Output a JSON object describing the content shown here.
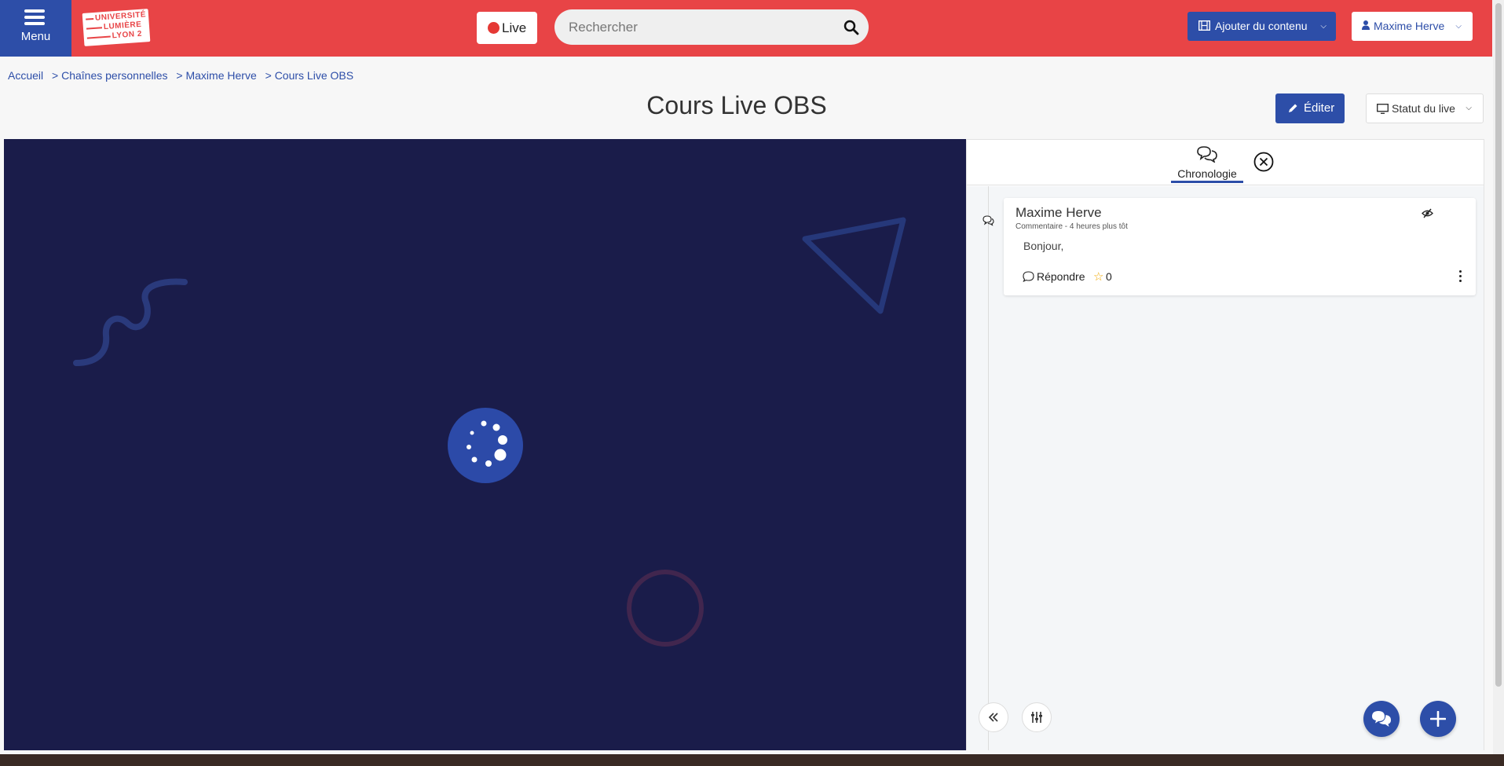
{
  "header": {
    "menu_label": "Menu",
    "logo_lines": [
      "UNIVERSITÉ",
      "LUMIÈRE",
      "LYON 2"
    ],
    "live_label": "Live",
    "search_placeholder": "Rechercher",
    "add_content_label": "Ajouter du contenu",
    "user_label": "Maxime Herve"
  },
  "breadcrumb": [
    {
      "label": "Accueil"
    },
    {
      "label": "> Chaînes personnelles"
    },
    {
      "label": "> Maxime Herve"
    },
    {
      "label": "> Cours Live OBS"
    }
  ],
  "page": {
    "title": "Cours Live OBS",
    "edit_label": "Éditer",
    "status_label": "Statut du live"
  },
  "panel": {
    "tab_label": "Chronologie",
    "comments": [
      {
        "author": "Maxime Herve",
        "meta": "Commentaire - 4 heures plus tôt",
        "text": "Bonjour,",
        "reply_label": "Répondre",
        "stars": "0"
      }
    ]
  },
  "colors": {
    "brand_red": "#e84446",
    "brand_blue": "#2d4ea8",
    "player_bg": "#1a1c4a"
  },
  "icons": {
    "menu": "hamburger-icon",
    "live": "red-dot-icon",
    "search": "magnifier-icon",
    "add": "film-icon",
    "user": "user-icon",
    "edit": "pencil-icon",
    "status": "monitor-icon",
    "tab": "chat-bubbles-icon",
    "close": "close-circle-icon",
    "collapse": "double-chevron-left-icon",
    "settings": "sliders-icon",
    "chat_fab": "chat-icon",
    "add_fab": "plus-icon"
  }
}
